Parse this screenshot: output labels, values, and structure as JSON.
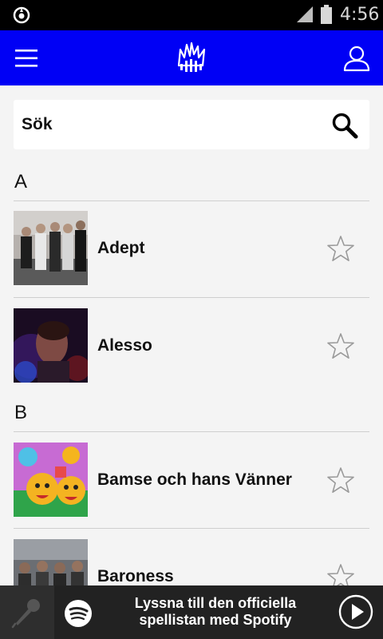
{
  "status_bar": {
    "time": "4:56"
  },
  "header": {
    "menu_icon": "hamburger-icon",
    "logo_icon": "festival-logo-icon",
    "user_icon": "user-icon"
  },
  "search": {
    "placeholder": "Sök",
    "icon": "search-icon"
  },
  "sections": [
    {
      "letter": "A",
      "artists": [
        {
          "name": "Adept"
        },
        {
          "name": "Alesso"
        }
      ]
    },
    {
      "letter": "B",
      "artists": [
        {
          "name": "Bamse och hans Vänner"
        },
        {
          "name": "Baroness"
        }
      ]
    }
  ],
  "player": {
    "cta_line1": "Lyssna till den officiella",
    "cta_line2": "spellistan med Spotify",
    "colors": {
      "bar": "#222222",
      "accent_header": "#0000f5"
    }
  }
}
